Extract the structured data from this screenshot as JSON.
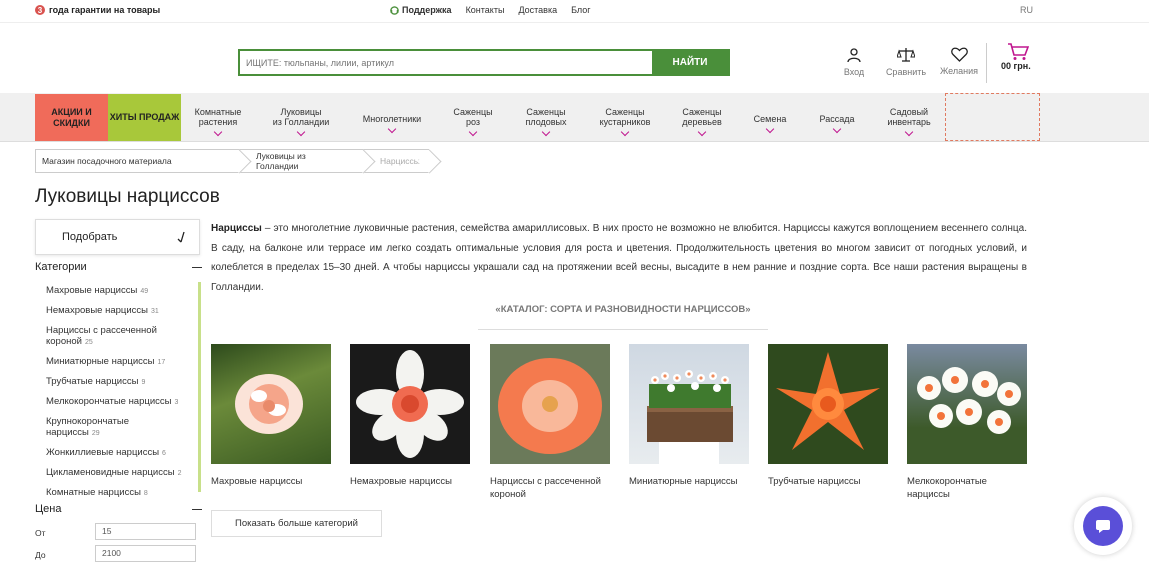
{
  "topbar": {
    "warranty_num": "3",
    "warranty_text": "года гарантии на товары",
    "support": "Поддержка",
    "contacts": "Контакты",
    "delivery": "Доставка",
    "blog": "Блог",
    "lang": "RU"
  },
  "header": {
    "search_placeholder": "ИЩИТЕ: тюльпаны, лилии, артикул",
    "search_button": "НАЙТИ",
    "login": "Вход",
    "compare": "Сравнить",
    "wishlist": "Желания",
    "cart_amount": "00 грн."
  },
  "nav": {
    "promo1": "АКЦИИ И СКИДКИ",
    "promo2": "ХИТЫ ПРОДАЖ",
    "items": [
      {
        "l1": "Комнатные",
        "l2": "растения"
      },
      {
        "l1": "Луковицы",
        "l2": "из Голландии"
      },
      {
        "l1": "Многолетники",
        "l2": ""
      },
      {
        "l1": "Саженцы",
        "l2": "роз"
      },
      {
        "l1": "Саженцы",
        "l2": "плодовых"
      },
      {
        "l1": "Саженцы",
        "l2": "кустарников"
      },
      {
        "l1": "Саженцы",
        "l2": "деревьев"
      },
      {
        "l1": "Семена",
        "l2": ""
      },
      {
        "l1": "Рассада",
        "l2": ""
      },
      {
        "l1": "Садовый",
        "l2": "инвентарь"
      }
    ]
  },
  "breadcrumbs": [
    "Магазин посадочного материала",
    "Луковицы из Голландии",
    "Нарциссы"
  ],
  "page_title": "Луковицы нарциссов",
  "sidebar": {
    "filter_button": "Подобрать",
    "categories_title": "Категории",
    "categories": [
      {
        "name": "Махровые нарциссы",
        "count": "49"
      },
      {
        "name": "Немахровые нарциссы",
        "count": "31"
      },
      {
        "name": "Нарциссы с рассеченной короной",
        "count": "25"
      },
      {
        "name": "Миниатюрные нарциссы",
        "count": "17"
      },
      {
        "name": "Трубчатые нарциссы",
        "count": "9"
      },
      {
        "name": "Мелкокорончатые нарциссы",
        "count": "3"
      },
      {
        "name": "Крупнокорончатые нарциссы",
        "count": "29"
      },
      {
        "name": "Жонкиллиевые нарциссы",
        "count": "6"
      },
      {
        "name": "Цикламеновидные нарциссы",
        "count": "2"
      },
      {
        "name": "Комнатные нарциссы",
        "count": "8"
      }
    ],
    "price_title": "Цена",
    "price_from_label": "От",
    "price_from": "15",
    "price_to_label": "До",
    "price_to": "2100"
  },
  "description": {
    "bold": "Нарциссы",
    "text": " – это многолетние луковичные растения, семейства амариллисовых. В них просто не возможно не влюбится. Нарциссы кажутся воплощением весеннего солнца. В саду, на балконе или террасе им легко создать оптимальные условия для роста и цветения. Продолжительность цветения во многом зависит от погодных условий, и колеблется в пределах 15–30 дней. А чтобы нарциссы украшали сад на протяжении всей весны, высадите в нем ранние и поздние сорта. Все наши растения выращены в Голландии."
  },
  "catalog": {
    "title": "«КАТАЛОГ: СОРТА И РАЗНОВИДНОСТИ НАРЦИССОВ»",
    "cards": [
      {
        "label": "Махровые нарциссы"
      },
      {
        "label": "Немахровые нарциссы"
      },
      {
        "label": "Нарциссы с рассеченной короной"
      },
      {
        "label": "Миниатюрные нарциссы"
      },
      {
        "label": "Трубчатые нарциссы"
      },
      {
        "label": "Мелкокорончатые нарциссы"
      }
    ],
    "more_button": "Показать больше категорий"
  },
  "colors": {
    "accent_green": "#4a8f3a",
    "promo_red": "#f06b5a",
    "promo_green": "#a8c83a",
    "accent_purple": "#c0168f",
    "chat": "#5a4fd8"
  }
}
